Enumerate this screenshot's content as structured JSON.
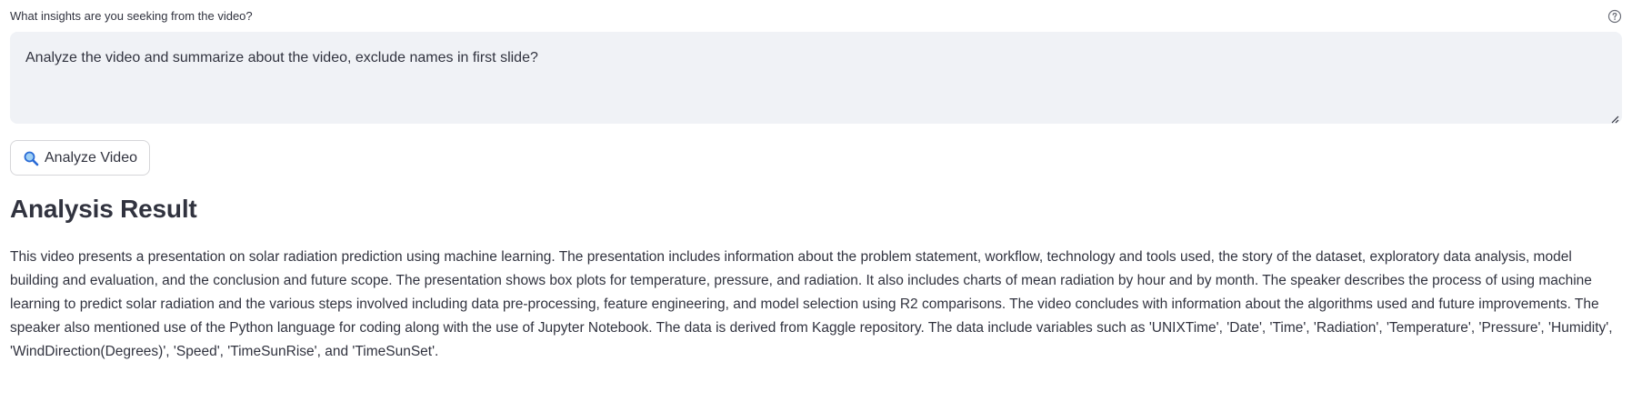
{
  "query": {
    "label": "What insights are you seeking from the video?",
    "help_icon": "question-circle-icon",
    "value": "Analyze the video and summarize about the video, exclude names in first slide?"
  },
  "analyze_button": {
    "icon": "magnifier-icon",
    "label": "Analyze Video"
  },
  "result": {
    "title": "Analysis Result",
    "text": "This video presents a presentation on solar radiation prediction using machine learning. The presentation includes information about the problem statement, workflow, technology and tools used, the story of the dataset, exploratory data analysis, model building and evaluation, and the conclusion and future scope. The presentation shows box plots for temperature, pressure, and radiation. It also includes charts of mean radiation by hour and by month. The speaker describes the process of using machine learning to predict solar radiation and the various steps involved including data pre-processing, feature engineering, and model selection using R2 comparisons. The video concludes with information about the algorithms used and future improvements. The speaker also mentioned use of the Python language for coding along with the use of Jupyter Notebook. The data is derived from Kaggle repository. The data include variables such as 'UNIXTime', 'Date', 'Time', 'Radiation', 'Temperature', 'Pressure', 'Humidity', 'WindDirection(Degrees)', 'Speed', 'TimeSunRise', and 'TimeSunSet'."
  },
  "colors": {
    "text": "#31333f",
    "input_background": "#f0f2f6",
    "button_border": "#d6d6d9",
    "icon_blue": "#2a6bd6"
  }
}
